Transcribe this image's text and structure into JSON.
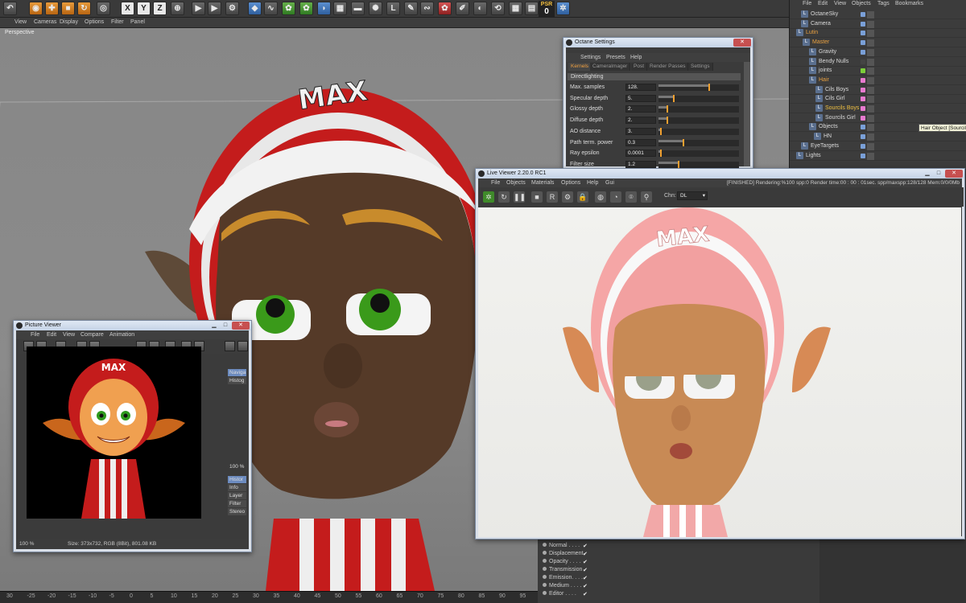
{
  "toolbar": {
    "axis_x": "X",
    "axis_y": "Y",
    "axis_z": "Z",
    "psr_label": "PSR",
    "psr_value": "0"
  },
  "viewport": {
    "menu": [
      "View",
      "Cameras",
      "Display",
      "Options",
      "Filter",
      "Panel"
    ],
    "label": "Perspective",
    "ruler": [
      "30",
      "-25",
      "-20",
      "-15",
      "-10",
      "-5",
      "0",
      "5",
      "10",
      "15",
      "20",
      "25",
      "30",
      "35",
      "40",
      "45",
      "50",
      "55",
      "60",
      "65",
      "70",
      "75",
      "80",
      "85",
      "90",
      "95",
      "100"
    ],
    "hat_text": "MAX"
  },
  "object_manager": {
    "menu": [
      "File",
      "Edit",
      "View",
      "Objects",
      "Tags",
      "Bookmarks"
    ],
    "rows": [
      {
        "name": "OctaneSky",
        "color": "#d9d9d9",
        "sw": "#7aa0d8"
      },
      {
        "name": "Camera",
        "color": "#d9d9d9",
        "sw": "#7aa0d8"
      },
      {
        "name": "Lutin",
        "color": "#e8a040",
        "sw": "#7aa0d8"
      },
      {
        "name": "Master",
        "color": "#e8a040",
        "sw": "#7aa0d8"
      },
      {
        "name": "Gravity",
        "color": "#d9d9d9",
        "sw": "#7aa0d8"
      },
      {
        "name": "Bendy Nulls",
        "color": "#d9d9d9",
        "sw": "#444444"
      },
      {
        "name": "joints",
        "color": "#d9d9d9",
        "sw": "#7ccf3a"
      },
      {
        "name": "Hair",
        "color": "#e8a040",
        "sw": "#e87ad0"
      },
      {
        "name": "Cils Boys",
        "color": "#d9d9d9",
        "sw": "#e87ad0"
      },
      {
        "name": "Cils Girl",
        "color": "#d9d9d9",
        "sw": "#e87ad0"
      },
      {
        "name": "Sourcils Boys",
        "color": "#f0c040",
        "sw": "#e87ad0"
      },
      {
        "name": "Sourcils Girl",
        "color": "#d9d9d9",
        "sw": "#e87ad0"
      },
      {
        "name": "Objects",
        "color": "#d9d9d9",
        "sw": "#7aa0d8"
      },
      {
        "name": "HN",
        "color": "#d9d9d9",
        "sw": "#7aa0d8"
      },
      {
        "name": "EyeTargets",
        "color": "#d9d9d9",
        "sw": "#7aa0d8"
      },
      {
        "name": "Lights",
        "color": "#d9d9d9",
        "sw": "#7aa0d8"
      }
    ],
    "tooltip": "Hair Object [Sourcils"
  },
  "materials": {
    "rows": [
      "Normal . . . .",
      "Displacement",
      "Opacity . . . .",
      "Transmission",
      "Emission. . . .",
      "Medium . . . .",
      "Editor . . . ."
    ]
  },
  "octane": {
    "title": "Octane Settings",
    "menu": [
      "Settings",
      "Presets",
      "Help"
    ],
    "tabs": [
      "Kernels",
      "CameraImager",
      "Post",
      "Render Passes",
      "Settings"
    ],
    "section": "Directlighting",
    "rows": [
      {
        "label": "Max. samples",
        "value": "128.",
        "knob": 0.62
      },
      {
        "label": "Specular depth",
        "value": "5.",
        "knob": 0.18
      },
      {
        "label": "Glossy depth",
        "value": "2.",
        "knob": 0.1
      },
      {
        "label": "Diffuse depth",
        "value": "2.",
        "knob": 0.1
      },
      {
        "label": "AO distance",
        "value": "3.",
        "knob": 0.02
      },
      {
        "label": "Path term. power",
        "value": "0.3",
        "knob": 0.3
      },
      {
        "label": "Ray epsilon",
        "value": "0.0001",
        "knob": 0.02
      },
      {
        "label": "Filter size",
        "value": "1.2",
        "knob": 0.24
      }
    ]
  },
  "picture_viewer": {
    "title": "Picture Viewer",
    "menu": [
      "File",
      "Edit",
      "View",
      "Compare",
      "Animation"
    ],
    "side": [
      "Naviga",
      "Histog",
      "100 %",
      "Histor",
      "Info",
      "Layer",
      "Filter",
      "Stereo",
      "Histo",
      "Nam"
    ],
    "zoom": "100 %",
    "status": "Size: 373x732, RGB (8Bit), 801.08 KB",
    "hat_text": "MAX"
  },
  "live_viewer": {
    "title": "Live Viewer 2.20.0 RC1",
    "menu": [
      "File",
      "Objects",
      "Materials",
      "Options",
      "Help",
      "Gui"
    ],
    "status": "[FINISHED]  Rendering:%100 spp:0 Render time:00 : 00 : 01sec. spp/maxspp:128/128 Mem:0/0/0Mb",
    "chn_label": "Chn:",
    "chn_value": "DL",
    "hat_text": "MAX"
  }
}
